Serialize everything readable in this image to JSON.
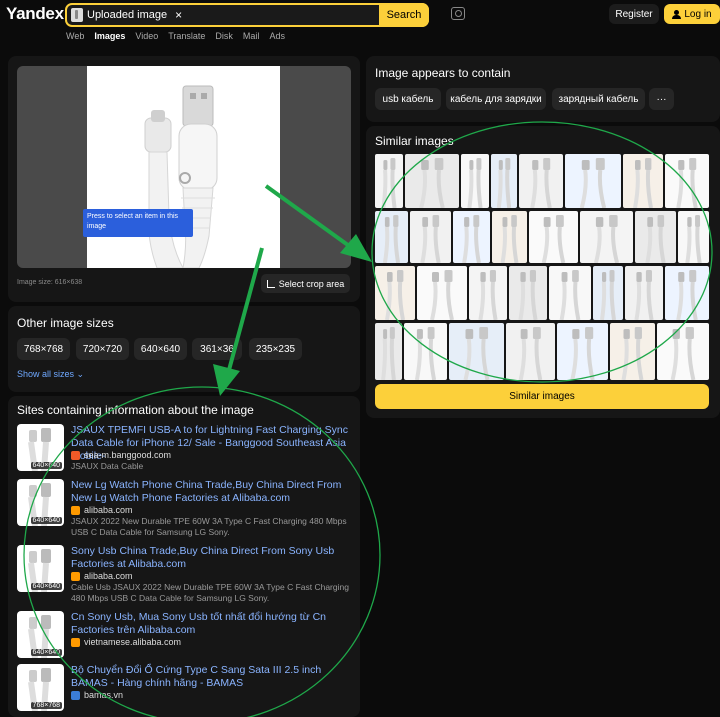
{
  "header": {
    "logo": "Yandex",
    "search_chip": "Uploaded image",
    "search_close": "×",
    "search_button": "Search",
    "register": "Register",
    "login": "Log in",
    "nav": [
      "Web",
      "Images",
      "Video",
      "Translate",
      "Disk",
      "Mail",
      "Ads"
    ],
    "nav_active": "Images"
  },
  "preview": {
    "tooltip": "Press to select an item in this image",
    "image_size": "Image size: 616×638",
    "crop_button": "Select crop area"
  },
  "other_sizes": {
    "title": "Other image sizes",
    "sizes": [
      "768×768",
      "720×720",
      "640×640",
      "361×36",
      "235×235"
    ],
    "show_all": "Show all sizes"
  },
  "sites": {
    "title": "Sites containing information about the image",
    "items": [
      {
        "title": "JSAUX TPEMFI USB-A to for Lightning Fast Charging Sync Data Cable for iPhone 12/ Sale - Banggood Southeast Asia Mobile-",
        "domain": "sea-m.banggood.com",
        "desc": "JSAUX Data Cable",
        "res": "640×640",
        "fav_color": "#f05a28"
      },
      {
        "title": "New Lg Watch Phone China Trade,Buy China Direct From New Lg Watch Phone Factories at Alibaba.com",
        "domain": "alibaba.com",
        "desc": "JSAUX 2022 New Durable TPE 60W 3A Type C Fast Charging 480 Mbps USB C Data Cable for Samsung LG Sony.",
        "res": "640×640",
        "fav_color": "#ff9a00"
      },
      {
        "title": "Sony Usb China Trade,Buy China Direct From Sony Usb Factories at Alibaba.com",
        "domain": "alibaba.com",
        "desc": "Cable Usb JSAUX 2022 New Durable TPE 60W 3A Type C Fast Charging 480 Mbps USB C Data Cable for Samsung LG Sony.",
        "res": "640×640",
        "fav_color": "#ff9a00"
      },
      {
        "title": "Cn Sony Usb, Mua Sony Usb tốt nhất đổi hướng từ Cn Factories trên Alibaba.com",
        "domain": "vietnamese.alibaba.com",
        "desc": "",
        "res": "640×640",
        "fav_color": "#ff9a00"
      },
      {
        "title": "Bộ Chuyển Đổi Ổ Cứng Type C Sang Sata III 2.5 inch BAMAS - Hàng chính hãng - BAMAS",
        "domain": "bamas.vn",
        "desc": "",
        "res": "768×768",
        "fav_color": "#3b7dd8"
      }
    ]
  },
  "contains": {
    "title": "Image appears to contain",
    "tags": [
      "usb кабель",
      "кабель для зарядки",
      "зарядный кабель"
    ],
    "more": "···"
  },
  "similar": {
    "title": "Similar images",
    "button": "Similar images"
  },
  "colors": {
    "accent": "#fcd03a",
    "link": "#8ab4ff",
    "annotation": "#1fa84a"
  }
}
